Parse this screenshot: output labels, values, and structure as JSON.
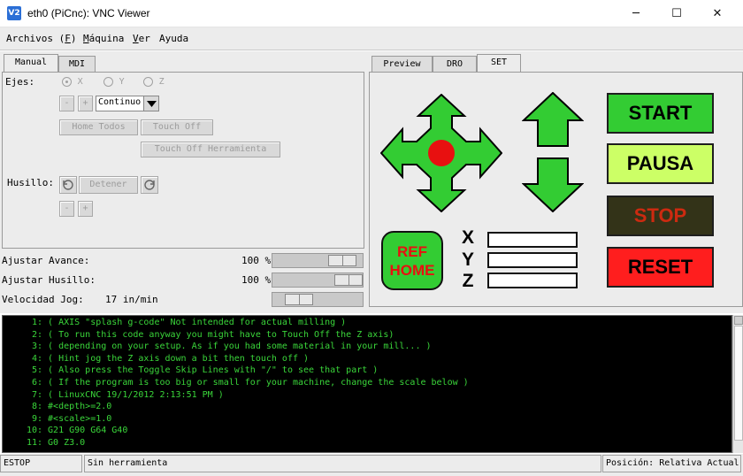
{
  "window": {
    "icon": "vnc-icon",
    "title": "eth0 (PiCnc): VNC Viewer",
    "controls": [
      "─",
      "☐",
      "✕"
    ]
  },
  "menu": {
    "archivos": {
      "pre": "Archivos (",
      "u": "F",
      "post": ")"
    },
    "maquina": {
      "u": "M",
      "post": "áquina"
    },
    "ver": {
      "u": "V",
      "post": "er"
    },
    "ayuda": {
      "label": "Ayuda"
    }
  },
  "left_tabs": [
    "Manual",
    "MDI"
  ],
  "manual": {
    "ejes_label": "Ejes:",
    "axes": [
      "X",
      "Y",
      "Z"
    ],
    "minus": "-",
    "plus": "+",
    "jog_mode": "Continuo",
    "home_todos": "Home Todos",
    "touch_off": "Touch Off",
    "touch_off_herramienta": "Touch Off Herramienta",
    "husillo_label": "Husillo:",
    "detener": "Detener",
    "minus2": "-",
    "plus2": "+"
  },
  "overrides": {
    "avance_label": "Ajustar Avance:",
    "avance_value": "100 %",
    "avance_fraction": 0.9,
    "husillo_label": "Ajustar Husillo:",
    "husillo_value": "100 %",
    "husillo_fraction": 1.0,
    "jog_label": "Velocidad Jog:",
    "jog_value": "17 in/min",
    "jog_fraction": 0.2
  },
  "right_tabs": [
    "Preview",
    "DRO",
    "SET"
  ],
  "set_panel": {
    "start": "START",
    "pausa": "PAUSA",
    "stop": "STOP",
    "reset": "RESET",
    "ref_home_1": "REF",
    "ref_home_2": "HOME",
    "axes": [
      "X",
      "Y",
      "Z"
    ],
    "colors": {
      "green": "#33cc33",
      "yellow_green": "#ccff66",
      "dark_olive": "#333318",
      "stop_text": "#cc2a10",
      "red": "#ff1e1e",
      "jog_center": "#e81010"
    }
  },
  "gcode": [
    {
      "n": "1:",
      "text": "( AXIS \"splash g-code\" Not intended for actual milling )"
    },
    {
      "n": "2:",
      "text": "( To run this code anyway you might have to Touch Off the Z axis)"
    },
    {
      "n": "3:",
      "text": "( depending on your setup. As if you had some material in your mill... )"
    },
    {
      "n": "4:",
      "text": "( Hint jog the Z axis down a bit then touch off )"
    },
    {
      "n": "5:",
      "text": "( Also press the Toggle Skip Lines with \"/\" to see that part )"
    },
    {
      "n": "6:",
      "text": "( If the program is too big or small for your machine, change the scale below )"
    },
    {
      "n": "7:",
      "text": "( LinuxCNC 19/1/2012 2:13:51 PM )"
    },
    {
      "n": "8:",
      "text": "#<depth>=2.0"
    },
    {
      "n": "9:",
      "text": "#<scale>=1.0"
    },
    {
      "n": "10:",
      "text": "G21 G90 G64 G40"
    },
    {
      "n": "11:",
      "text": "G0 Z3.0"
    }
  ],
  "status": {
    "estop": "ESTOP",
    "tool": "Sin herramienta",
    "position": "Posición: Relativa Actual"
  }
}
